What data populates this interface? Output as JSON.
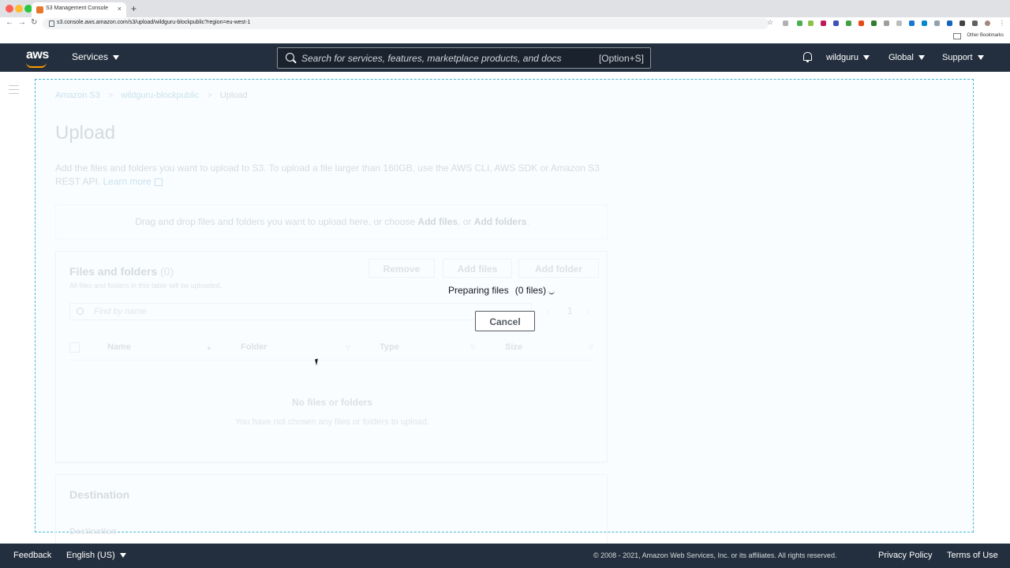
{
  "browser": {
    "tab_title": "S3 Management Console",
    "url": "s3.console.aws.amazon.com/s3/upload/wildguru-blockpublic?region=eu-west-1",
    "other_bookmarks": "Other Bookmarks",
    "new_tab_symbol": "+",
    "close_symbol": "×"
  },
  "nav": {
    "logo": "aws",
    "services": "Services",
    "search_placeholder": "Search for services, features, marketplace products, and docs",
    "search_shortcut": "[Option+S]",
    "account": "wildguru",
    "region": "Global",
    "support": "Support"
  },
  "breadcrumb": {
    "root": "Amazon S3",
    "bucket": "wildguru-blockpublic",
    "current": "Upload",
    "separator": ">"
  },
  "page": {
    "title": "Upload",
    "description": "Add the files and folders you want to upload to S3. To upload a file larger than 160GB, use the AWS CLI, AWS SDK or Amazon S3 REST API.",
    "learn_more": "Learn more"
  },
  "dropzone": {
    "text_prefix": "Drag and drop files and folders you want to upload here, or choose",
    "add_files": "Add files",
    "or": ", or",
    "add_folders": "Add folders",
    "period": "."
  },
  "files_panel": {
    "title": "Files and folders",
    "count": "(0)",
    "subtitle": "All files and folders in this table will be uploaded.",
    "remove_button": "Remove",
    "add_files_button": "Add files",
    "add_folder_button": "Add folder",
    "find_placeholder": "Find by name",
    "page_number": "1",
    "prev_symbol": "‹",
    "next_symbol": "›",
    "columns": [
      "Name",
      "Folder",
      "Type",
      "Size"
    ],
    "empty_title": "No files or folders",
    "empty_subtitle": "You have not chosen any files or folders to upload."
  },
  "destination": {
    "title": "Destination",
    "label": "Destination"
  },
  "overlay": {
    "status": "Preparing files",
    "count": "(0 files)",
    "cancel": "Cancel"
  },
  "footer": {
    "feedback": "Feedback",
    "language": "English (US)",
    "copyright": "© 2008 - 2021, Amazon Web Services, Inc. or its affiliates. All rights reserved.",
    "privacy": "Privacy Policy",
    "terms": "Terms of Use"
  },
  "colors": {
    "nav_bg": "#232f3e",
    "accent": "#ff9900",
    "dropzone_border": "#44b9d6"
  }
}
